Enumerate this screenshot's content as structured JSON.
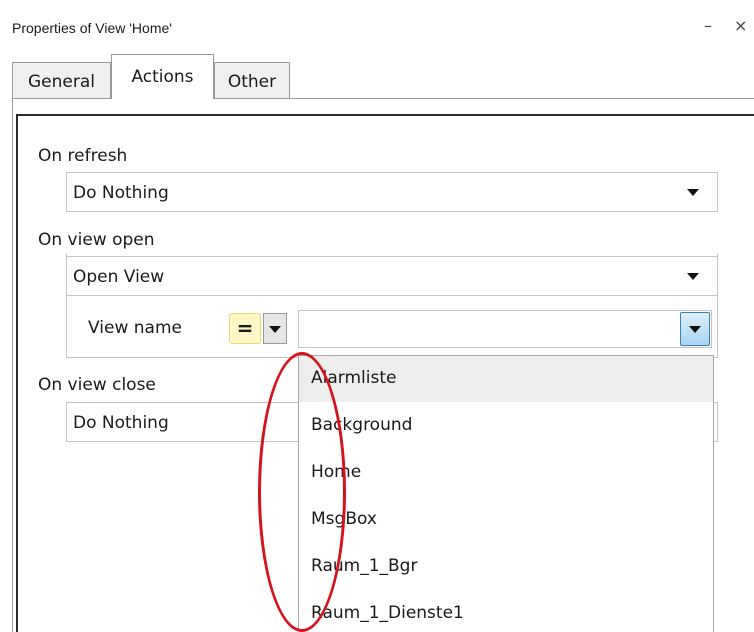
{
  "window": {
    "title": "Properties of View 'Home'",
    "minimize_label": "–",
    "close_label": "×"
  },
  "tabs": [
    {
      "label": "General",
      "active": false
    },
    {
      "label": "Actions",
      "active": true
    },
    {
      "label": "Other",
      "active": false
    }
  ],
  "on_refresh": {
    "label": "On refresh",
    "value": "Do Nothing"
  },
  "on_view_open": {
    "label": "On view open",
    "value": "Open View",
    "view_name_label": "View name",
    "eq_button_label": "=",
    "view_name_value": ""
  },
  "on_view_close": {
    "label": "On view close",
    "value": "Do Nothing"
  },
  "view_name_dropdown": {
    "items": [
      "Alarmliste",
      "Background",
      "Home",
      "MsgBox",
      "Raum_1_Bgr",
      "Raum_1_Dienste1"
    ],
    "highlighted_index": 0
  },
  "colors": {
    "annotation": "#d6121c",
    "eq_button_bg": "#fff7c6",
    "dropdown_button": "#a8d4f2"
  }
}
